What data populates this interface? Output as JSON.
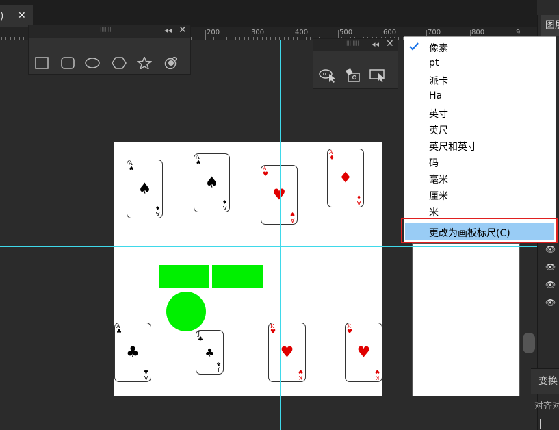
{
  "tab": {
    "label": ")",
    "close": "✕"
  },
  "ruler": {
    "labels": [
      "200",
      "300",
      "400",
      "500",
      "600",
      "700",
      "800",
      "9"
    ]
  },
  "right_panel": {
    "layers_tab": "图层",
    "transform_tab": "变换",
    "align_label": "对齐对"
  },
  "shape_panel": {
    "grip": "||||||||",
    "collapse": "◂◂",
    "close": "✕",
    "icons": [
      "rectangle-icon",
      "rounded-rectangle-icon",
      "ellipse-icon",
      "hexagon-icon",
      "star-icon",
      "spiral-icon"
    ]
  },
  "tool_panel": {
    "grip": "||||||||",
    "collapse": "◂◂",
    "close": "✕",
    "icons": [
      "speech-cursor-icon",
      "fill-bucket-icon",
      "screen-cursor-icon"
    ]
  },
  "menu": {
    "items": [
      {
        "label": "像素",
        "checked": true
      },
      {
        "label": "pt"
      },
      {
        "label": "派卡"
      },
      {
        "label": "Ha"
      },
      {
        "label": "英寸"
      },
      {
        "label": "英尺"
      },
      {
        "label": "英尺和英寸"
      },
      {
        "label": "码"
      },
      {
        "label": "毫米"
      },
      {
        "label": "厘米"
      },
      {
        "label": "米"
      }
    ],
    "selected_item": "更改为画板标尺(C)",
    "check": "✓"
  },
  "cards": [
    {
      "rank": "A",
      "suit": "♠",
      "color": "black"
    },
    {
      "rank": "A",
      "suit": "♠",
      "color": "black"
    },
    {
      "rank": "A",
      "suit": "♥",
      "color": "red"
    },
    {
      "rank": "A",
      "suit": "♦",
      "color": "red"
    },
    {
      "rank": "A",
      "suit": "♣",
      "color": "black"
    },
    {
      "rank": "J",
      "suit": "♣",
      "color": "black"
    },
    {
      "rank": "K",
      "suit": "♥",
      "color": "red"
    },
    {
      "rank": "K",
      "suit": "♥",
      "color": "red"
    }
  ],
  "colors": {
    "guide": "#3fd9ea",
    "green": "#00f000",
    "card_red": "#e00000",
    "selection": "#99ccf5",
    "highlight_border": "#e02020"
  },
  "layers_eye_icon": "👁"
}
